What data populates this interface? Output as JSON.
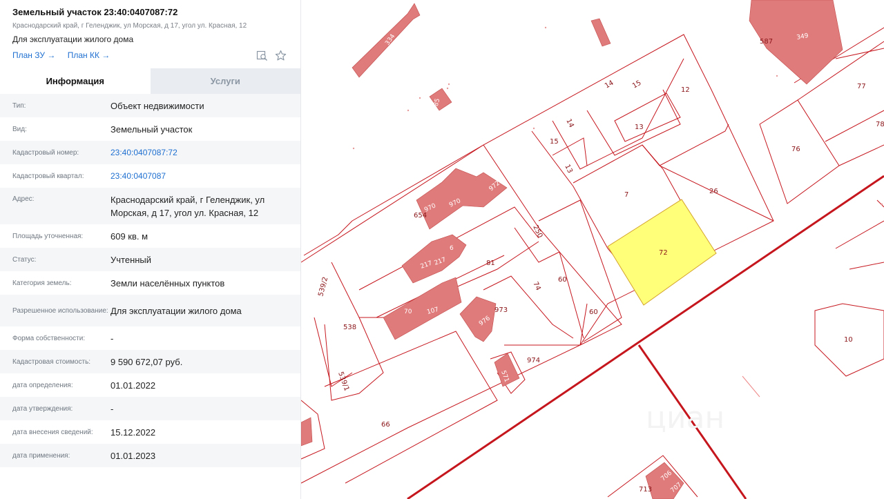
{
  "object": {
    "title": "Земельный участок 23:40:0407087:72",
    "address_short": "Краснодарский край, г Геленджик, ул Морская, д 17, угол ул. Красная, 12",
    "use": "Для эксплуатации жилого дома",
    "links": [
      "План ЗУ →",
      "План КК →"
    ],
    "icons": [
      "search-map-icon",
      "star-icon"
    ]
  },
  "tabs": [
    {
      "label": "Информация",
      "active": true
    },
    {
      "label": "Услуги",
      "active": false
    }
  ],
  "fields": [
    {
      "key": "Тип:",
      "value": "Объект недвижимости"
    },
    {
      "key": "Вид:",
      "value": "Земельный участок"
    },
    {
      "key": "Кадастровый номер:",
      "value": "23:40:0407087:72",
      "link": true
    },
    {
      "key": "Кадастровый квартал:",
      "value": "23:40:0407087",
      "link": true
    },
    {
      "key": "Адрес:",
      "value": "Краснодарский край, г Геленджик, ул Морская, д 17, угол ул. Красная, 12"
    },
    {
      "key": "Площадь уточненная:",
      "value": "609 кв. м"
    },
    {
      "key": "Статус:",
      "value": "Учтенный"
    },
    {
      "key": "Категория земель:",
      "value": "Земли населённых пунктов"
    },
    {
      "key": "Разрешенное использование:",
      "value": "Для эксплуатации жилого дома"
    },
    {
      "key": "Форма собственности:",
      "value": "-"
    },
    {
      "key": "Кадастровая стоимость:",
      "value": "9 590 672,07 руб."
    },
    {
      "key": "дата определения:",
      "value": "01.01.2022"
    },
    {
      "key": "дата утверждения:",
      "value": "-"
    },
    {
      "key": "дата внесения сведений:",
      "value": "15.12.2022"
    },
    {
      "key": "дата применения:",
      "value": "01.01.2023"
    }
  ],
  "map": {
    "parcel_labels": [
      "72",
      "7",
      "26",
      "12",
      "13",
      "14",
      "15",
      "14",
      "15",
      "13",
      "76",
      "77",
      "78",
      "587",
      "349",
      "10",
      "60",
      "60",
      "74",
      "250",
      "81",
      "6",
      "217",
      "217",
      "654",
      "970",
      "970",
      "972",
      "70",
      "107",
      "973",
      "976",
      "974",
      "571",
      "538",
      "539/2",
      "539/1",
      "66",
      "334",
      "485",
      "706",
      "707",
      "713"
    ],
    "watermark": "циан",
    "colors": {
      "selected": "#ffff7a",
      "building": "#e07b7b",
      "border": "#c5161d"
    }
  }
}
